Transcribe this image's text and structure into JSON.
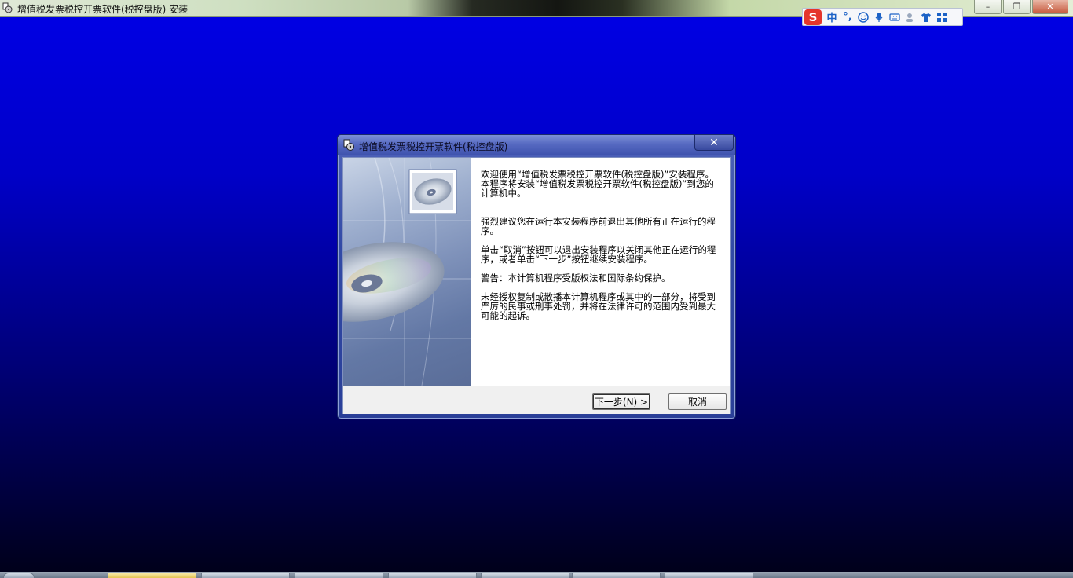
{
  "window": {
    "title": "增值税发票税控开票软件(税控盘版) 安装",
    "controls": {
      "minimize": "–",
      "restore": "❐",
      "close": "✕"
    }
  },
  "ime": {
    "logo": "S",
    "mode": "中",
    "punct": "°,"
  },
  "dialog": {
    "title": "增值税发票税控开票软件(税控盘版)",
    "close_glyph": "✕",
    "paragraphs": [
      "欢迎使用“增值税发票税控开票软件(税控盘版)”安装程序。本程序将安装“增值税发票税控开票软件(税控盘版)”到您的计算机中。",
      "强烈建议您在运行本安装程序前退出其他所有正在运行的程序。",
      "单击“取消”按钮可以退出安装程序以关闭其他正在运行的程序，或者单击“下一步”按钮继续安装程序。",
      "警告：本计算机程序受版权法和国际条约保护。",
      "未经授权复制或散播本计算机程序或其中的一部分，将受到严厉的民事或刑事处罚，并将在法律许可的范围内受到最大可能的起诉。"
    ],
    "buttons": {
      "next": "下一步(N) >",
      "cancel": "取消"
    }
  },
  "colors": {
    "desktop_top": "#0000e6",
    "desktop_bottom": "#000018",
    "dialog_frame": "#3e52ad",
    "ime_accent": "#e5352b"
  }
}
